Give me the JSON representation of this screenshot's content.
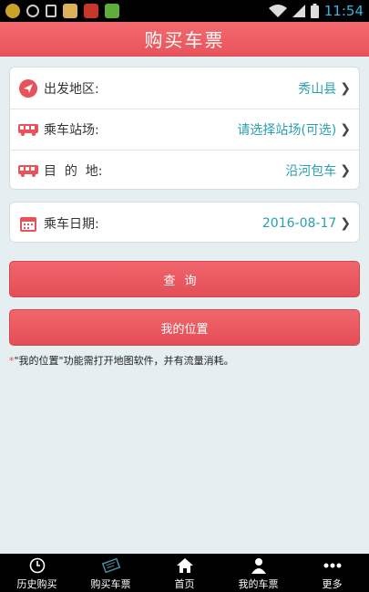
{
  "status_bar": {
    "time": "11:54"
  },
  "header": {
    "title": "购买车票"
  },
  "form": {
    "departure": {
      "label": "出发地区:",
      "value": "秀山县"
    },
    "station": {
      "label": "乘车站场:",
      "value": "请选择站场(可选)"
    },
    "destination": {
      "label": "目  的  地:",
      "value": "沿河包车"
    },
    "date": {
      "label": "乘车日期:",
      "value": "2016-08-17"
    }
  },
  "buttons": {
    "query": "查询",
    "my_location": "我的位置"
  },
  "note": {
    "star": "*",
    "text": "\"我的位置\"功能需打开地图软件，并有流量消耗。"
  },
  "bottom_nav": [
    {
      "label": "历史购买",
      "icon": "clock-icon"
    },
    {
      "label": "购买车票",
      "icon": "ticket-icon"
    },
    {
      "label": "首页",
      "icon": "home-icon"
    },
    {
      "label": "我的车票",
      "icon": "user-icon"
    },
    {
      "label": "更多",
      "icon": "more-icon"
    }
  ],
  "colors": {
    "accent": "#e9545c",
    "value_text": "#2a9fb0",
    "background": "#e5eef0"
  }
}
